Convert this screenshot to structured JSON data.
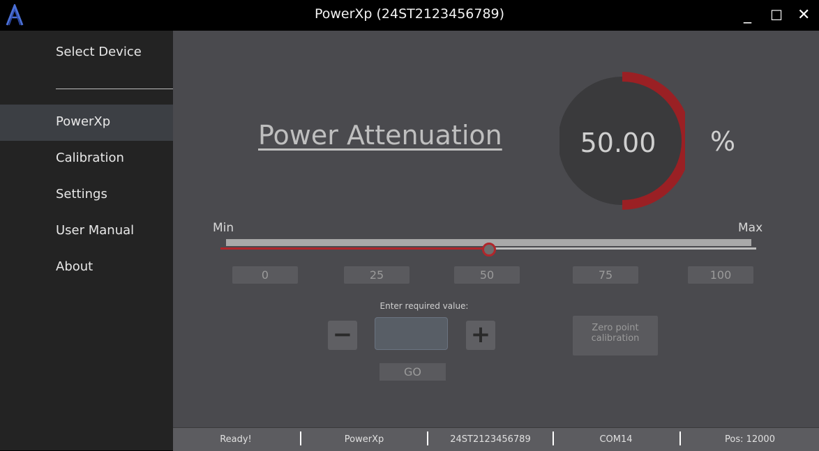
{
  "window": {
    "title": "PowerXp (24ST2123456789)",
    "minimize_glyph": "_",
    "maximize_glyph": "☐",
    "close_glyph": "✕",
    "logo_icon": "a-logo-icon"
  },
  "sidebar": {
    "select_device": "Select Device",
    "items": [
      {
        "label": "PowerXp",
        "active": true
      },
      {
        "label": "Calibration",
        "active": false
      },
      {
        "label": "Settings",
        "active": false
      },
      {
        "label": "User Manual",
        "active": false
      },
      {
        "label": "About",
        "active": false
      }
    ]
  },
  "main": {
    "heading": "Power Attenuation",
    "gauge_value": "50.00",
    "gauge_fraction": 0.5,
    "unit": "%",
    "slider": {
      "min_label": "Min",
      "max_label": "Max",
      "value_percent": 50
    },
    "presets": [
      "0",
      "25",
      "50",
      "75",
      "100"
    ],
    "enter_label": "Enter required value:",
    "minus_label": "−",
    "plus_label": "+",
    "input_value": "",
    "go_label": "GO",
    "zero_point": {
      "line1": "Zero point",
      "line2": "calibration"
    }
  },
  "status": {
    "state": "Ready!",
    "device": "PowerXp",
    "serial": "24ST2123456789",
    "port": "COM14",
    "position": "Pos: 12000"
  },
  "colors": {
    "accent_red": "#b0262b",
    "sidebar_bg": "#232323",
    "main_bg": "#4a4a4e"
  }
}
